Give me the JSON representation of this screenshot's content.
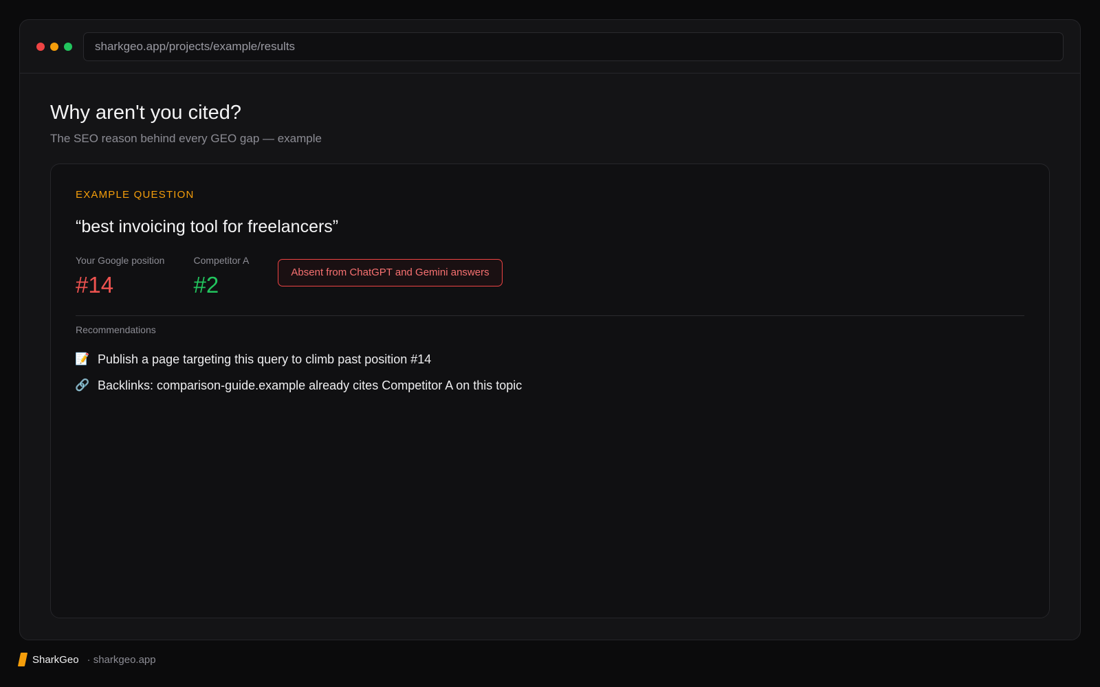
{
  "browser": {
    "url": "sharkgeo.app/projects/example/results",
    "dot_colors": [
      "#ef4444",
      "#f59e0b",
      "#22c55e"
    ]
  },
  "page": {
    "title": "Why aren't you cited?",
    "subtitle": "The SEO reason behind every GEO gap — example"
  },
  "card": {
    "eyebrow": "EXAMPLE QUESTION",
    "question": "“best invoicing tool for freelancers”",
    "stats": [
      {
        "label": "Your Google position",
        "value": "#14",
        "color": "#ef5350"
      },
      {
        "label": "Competitor A",
        "value": "#2",
        "color": "#22c55e"
      }
    ],
    "badge": "Absent from ChatGPT and Gemini answers",
    "recommendations_heading": "Recommendations",
    "recommendations": [
      {
        "icon": "memo-icon",
        "glyph": "📝",
        "text": "Publish a page targeting this query to climb past position #14"
      },
      {
        "icon": "link-icon",
        "glyph": "🔗",
        "text": "Backlinks: comparison-guide.example already cites Competitor A on this topic"
      }
    ]
  },
  "footer": {
    "brand": "SharkGeo",
    "domain": "· sharkgeo.app",
    "accent": "#f59e0b"
  }
}
